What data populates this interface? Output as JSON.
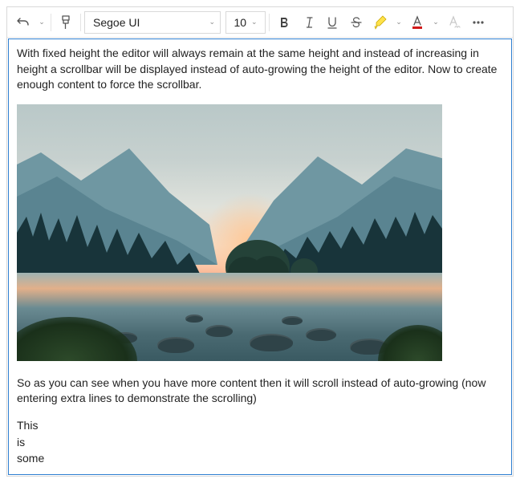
{
  "toolbar": {
    "font_name": "Segoe UI",
    "font_size": "10"
  },
  "content": {
    "para1": "With fixed height the editor will always remain at the same height and instead of increasing in height a scrollbar will be displayed instead of auto-growing the height of the editor. Now to create enough content to force the scrollbar.",
    "para2": "So as you can see when you have more content then it will scroll instead of auto-growing (now entering extra lines to demonstrate the scrolling)",
    "line1": "This",
    "line2": "is",
    "line3": "some"
  }
}
